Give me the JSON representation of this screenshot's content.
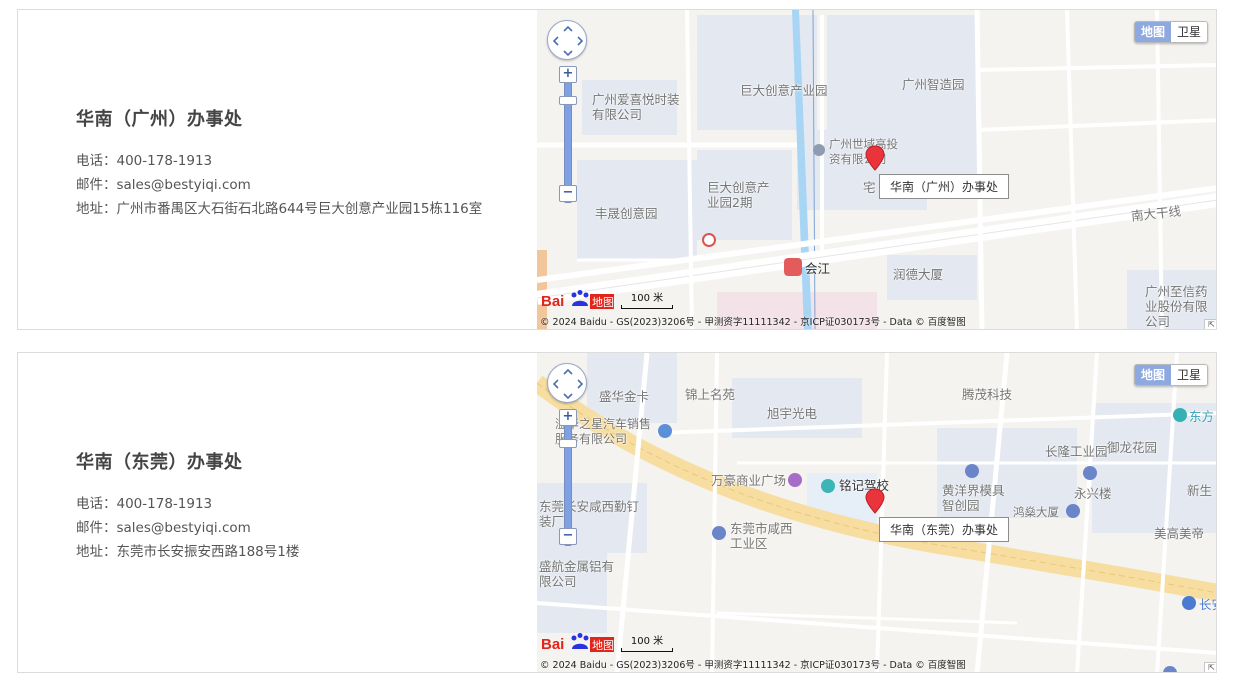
{
  "offices": [
    {
      "title": "华南（广州）办事处",
      "phone_label": "电话：",
      "phone": "400-178-1913",
      "email_label": "邮件：",
      "email": "sales@bestyiqi.com",
      "address_label": "地址：",
      "address": "广州市番禺区大石街石北路644号巨大创意产业园15栋116室",
      "map": {
        "type_active": "地图",
        "type_inactive": "卫星",
        "marker_label": "华南（广州）办事处",
        "scale_text": "100 米",
        "logo_text": "地图",
        "copyright": "© 2024 Baidu - GS(2023)3206号 - 甲测资字11111342 - 京ICP证030173号 - Data © 百度智图",
        "pois": [
          "广州爱喜悦时装有限公司",
          "巨大创意产业园",
          "广州智造园",
          "广州世域高投资有限公司",
          "巨大创意产业园2期",
          "丰晟创意园",
          "宅",
          "南大干线",
          "会江",
          "润德大厦",
          "广州至信药业股份有限公司"
        ]
      }
    },
    {
      "title": "华南（东莞）办事处",
      "phone_label": "电话：",
      "phone": "400-178-1913",
      "email_label": "邮件：",
      "email": "sales@bestyiqi.com",
      "address_label": "地址：",
      "address": "东莞市长安振安西路188号1楼",
      "map": {
        "type_active": "地图",
        "type_inactive": "卫星",
        "marker_label": "华南（东莞）办事处",
        "scale_text": "100 米",
        "logo_text": "地图",
        "copyright": "© 2024 Baidu - GS(2023)3206号 - 甲测资字11111342 - 京ICP证030173号 - Data © 百度智图",
        "pois": [
          "盛华金卡",
          "锦上名苑",
          "旭宇光电",
          "腾茂科技",
          "东方",
          "溢华之星汽车销售服务有限公司",
          "长隆工业园",
          "御龙花园",
          "万豪商业广场",
          "铭记驾校",
          "黄洋界模具智创园",
          "永兴楼",
          "新生",
          "东莞长安咸西勤钉装厂",
          "东莞市咸西工业区",
          "鸿燊大厦",
          "美高美帝",
          "盛航金属铝有限公司",
          "长安"
        ]
      }
    }
  ]
}
